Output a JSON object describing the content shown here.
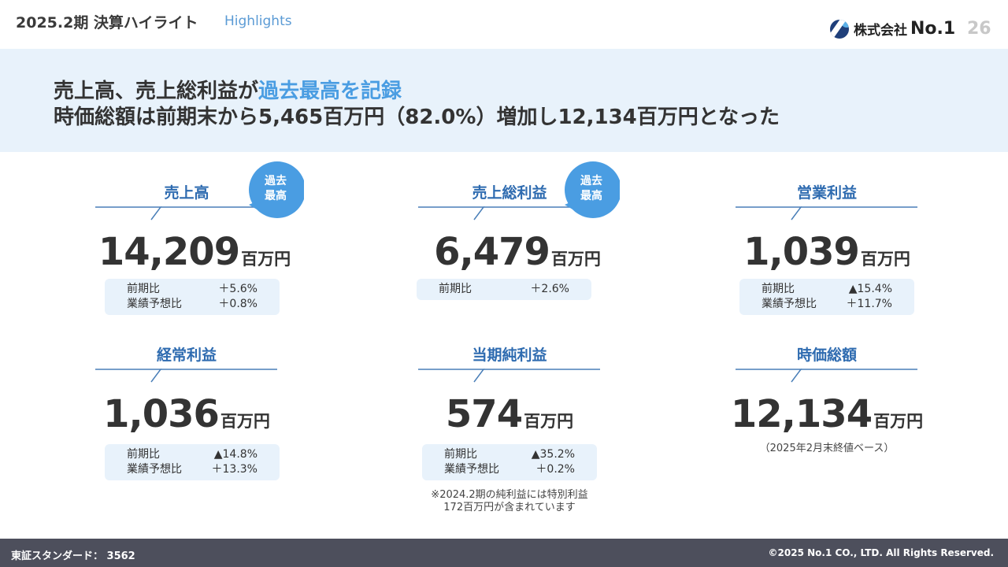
{
  "header": {
    "period_title": "2025.2期 決算ハイライト",
    "sub_title": "Highlights",
    "company_name": "株式会社",
    "company_no": "No.1",
    "page_number": "26"
  },
  "banner": {
    "line1_prefix": "売上高、売上総利益が",
    "line1_highlight": "過去最高を記録",
    "line2": "時価総額は前期末から5,465百万円（82.0%）増加し12,134百万円となった"
  },
  "badge_text": [
    "過去",
    "最高"
  ],
  "metrics": [
    {
      "label": "売上高",
      "value": "14,209",
      "unit": "百万円",
      "rows": [
        {
          "k": "前期比",
          "v": "＋5.6%"
        },
        {
          "k": "業績予想比",
          "v": "＋0.8%"
        }
      ]
    },
    {
      "label": "売上総利益",
      "value": "6,479",
      "unit": "百万円",
      "rows": [
        {
          "k": "前期比",
          "v": "＋2.6%"
        }
      ]
    },
    {
      "label": "営業利益",
      "value": "1,039",
      "unit": "百万円",
      "rows": [
        {
          "k": "前期比",
          "v": "▲15.4%"
        },
        {
          "k": "業績予想比",
          "v": "＋11.7%"
        }
      ]
    },
    {
      "label": "経常利益",
      "value": "1,036",
      "unit": "百万円",
      "rows": [
        {
          "k": "前期比",
          "v": "▲14.8%"
        },
        {
          "k": "業績予想比",
          "v": "＋13.3%"
        }
      ]
    },
    {
      "label": "当期純利益",
      "value": "574",
      "unit": "百万円",
      "rows": [
        {
          "k": "前期比",
          "v": "▲35.2%"
        },
        {
          "k": "業績予想比",
          "v": "＋0.2%"
        }
      ],
      "note": [
        "※2024.2期の純利益には特別利益",
        "172百万円が含まれています"
      ]
    },
    {
      "label": "時価総額",
      "value": "12,134",
      "unit": "百万円",
      "note": [
        "（2025年2月末終値ベース）"
      ]
    }
  ],
  "footer": {
    "listing": "東証スタンダード： 3562",
    "copyright": "©2025 No.1 CO., LTD. All Rights Reserved."
  }
}
